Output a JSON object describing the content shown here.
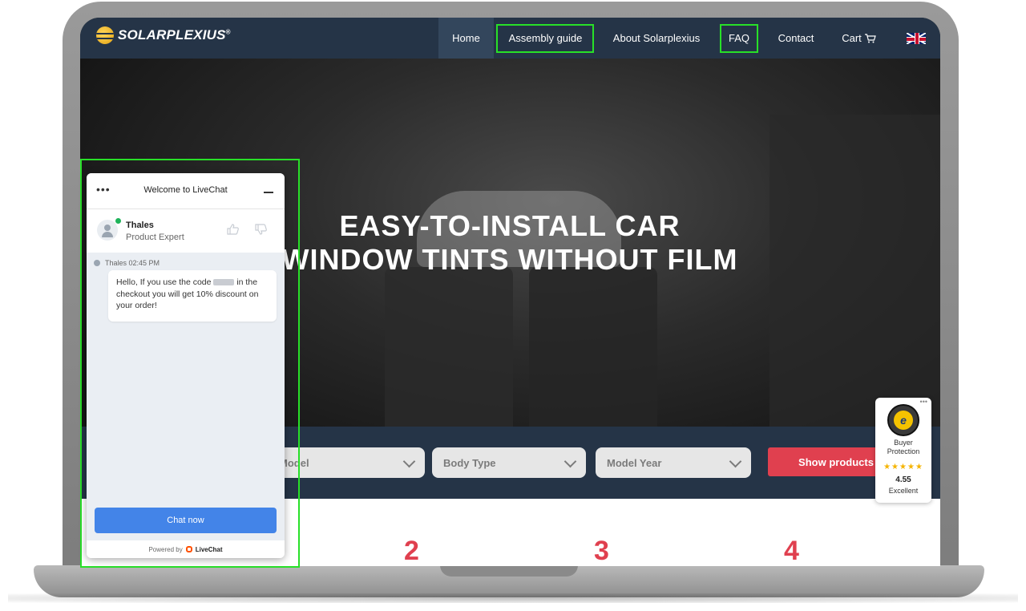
{
  "nav": {
    "logo": "SOLARPLEXIUS",
    "logo_mark": "®",
    "items": [
      "Home",
      "Assembly guide",
      "About Solarplexius",
      "FAQ",
      "Contact",
      "Cart"
    ],
    "language_flag_icon": "uk-flag-icon"
  },
  "hero": {
    "title_line1": "EASY-TO-INSTALL CAR",
    "title_line2": "WINDOW TINTS WITHOUT FILM"
  },
  "filters": {
    "model": "Model",
    "body_type": "Body Type",
    "model_year": "Model Year",
    "show_products": "Show products"
  },
  "steps": [
    "2",
    "3",
    "4"
  ],
  "chat": {
    "header_title": "Welcome to LiveChat",
    "agent_name": "Thales",
    "agent_role": "Product Expert",
    "message_meta": "Thales 02:45 PM",
    "message_part1": "Hello, If you use the code",
    "message_part2": "in the checkout you will get 10% discount on your order!",
    "chat_now": "Chat now",
    "powered_by": "Powered by",
    "brand": "LiveChat"
  },
  "trust_badge": {
    "line1": "Buyer",
    "line2": "Protection",
    "stars": "★★★★★",
    "score": "4.55",
    "rating": "Excellent"
  },
  "colors": {
    "nav_bg": "#253447",
    "accent_red": "#e0404f",
    "chat_button": "#4384e8",
    "highlight_green": "#28e028"
  }
}
